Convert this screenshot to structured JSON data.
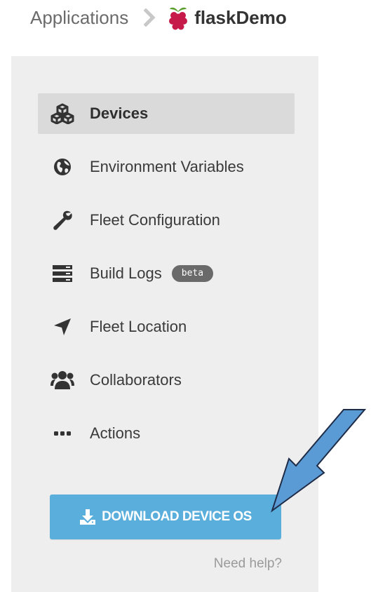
{
  "breadcrumb": {
    "parent": "Applications",
    "current": "flaskDemo",
    "app_icon": "raspberry-icon"
  },
  "sidebar": {
    "items": [
      {
        "label": "Devices",
        "icon": "cubes-icon",
        "active": true
      },
      {
        "label": "Environment Variables",
        "icon": "globe-icon",
        "active": false
      },
      {
        "label": "Fleet Configuration",
        "icon": "wrench-icon",
        "active": false
      },
      {
        "label": "Build Logs",
        "icon": "server-icon",
        "active": false,
        "badge": "beta"
      },
      {
        "label": "Fleet Location",
        "icon": "location-arrow-icon",
        "active": false
      },
      {
        "label": "Collaborators",
        "icon": "users-icon",
        "active": false
      },
      {
        "label": "Actions",
        "icon": "ellipsis-icon",
        "active": false
      }
    ]
  },
  "download": {
    "label": "DOWNLOAD DEVICE OS",
    "icon": "download-icon"
  },
  "help": {
    "label": "Need help?"
  },
  "colors": {
    "sidebar_bg": "#eeeeee",
    "active_item_bg": "#dadada",
    "button_bg": "#5aaedc",
    "annotation_arrow": "#5b9bd5"
  }
}
